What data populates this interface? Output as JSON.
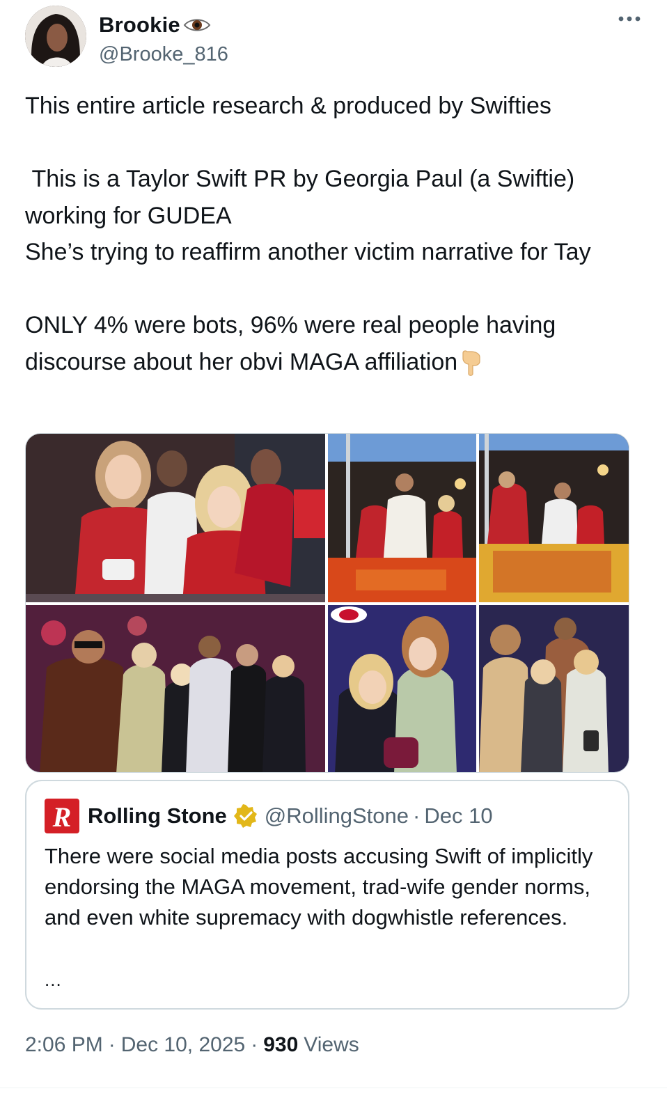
{
  "author": {
    "display_name": "Brookie",
    "name_emoji": "eye-icon",
    "handle": "@Brooke_816"
  },
  "tweet": {
    "text": "This entire article research & produced by Swifties\n\n This is a Taylor Swift PR by Georgia Paul (a Swiftie) working for GUDEA\nShe’s trying to reaffirm another victim narrative for Tay\n\nONLY 4% were bots, 96% were real people having discourse about her obvi MAGA affiliation",
    "trailing_emoji": "pointing-down-icon",
    "media_count": 6
  },
  "quote": {
    "name": "Rolling Stone",
    "handle": "@RollingStone",
    "separator": "·",
    "date": "Dec 10",
    "text": "There were social media posts accusing Swift of implicitly endorsing the MAGA movement, trad-wife gender norms, and even white supremacy with dogwhistle references.",
    "more": "..."
  },
  "meta": {
    "time": "2:06 PM",
    "separator": "·",
    "date": "Dec 10, 2025",
    "views_count": "930",
    "views_label": "Views"
  },
  "colors": {
    "text": "#0f1419",
    "secondary": "#536471",
    "border": "#cfd9de",
    "verified_gold": "#e2b719",
    "chiefs_red": "#c8102e"
  }
}
